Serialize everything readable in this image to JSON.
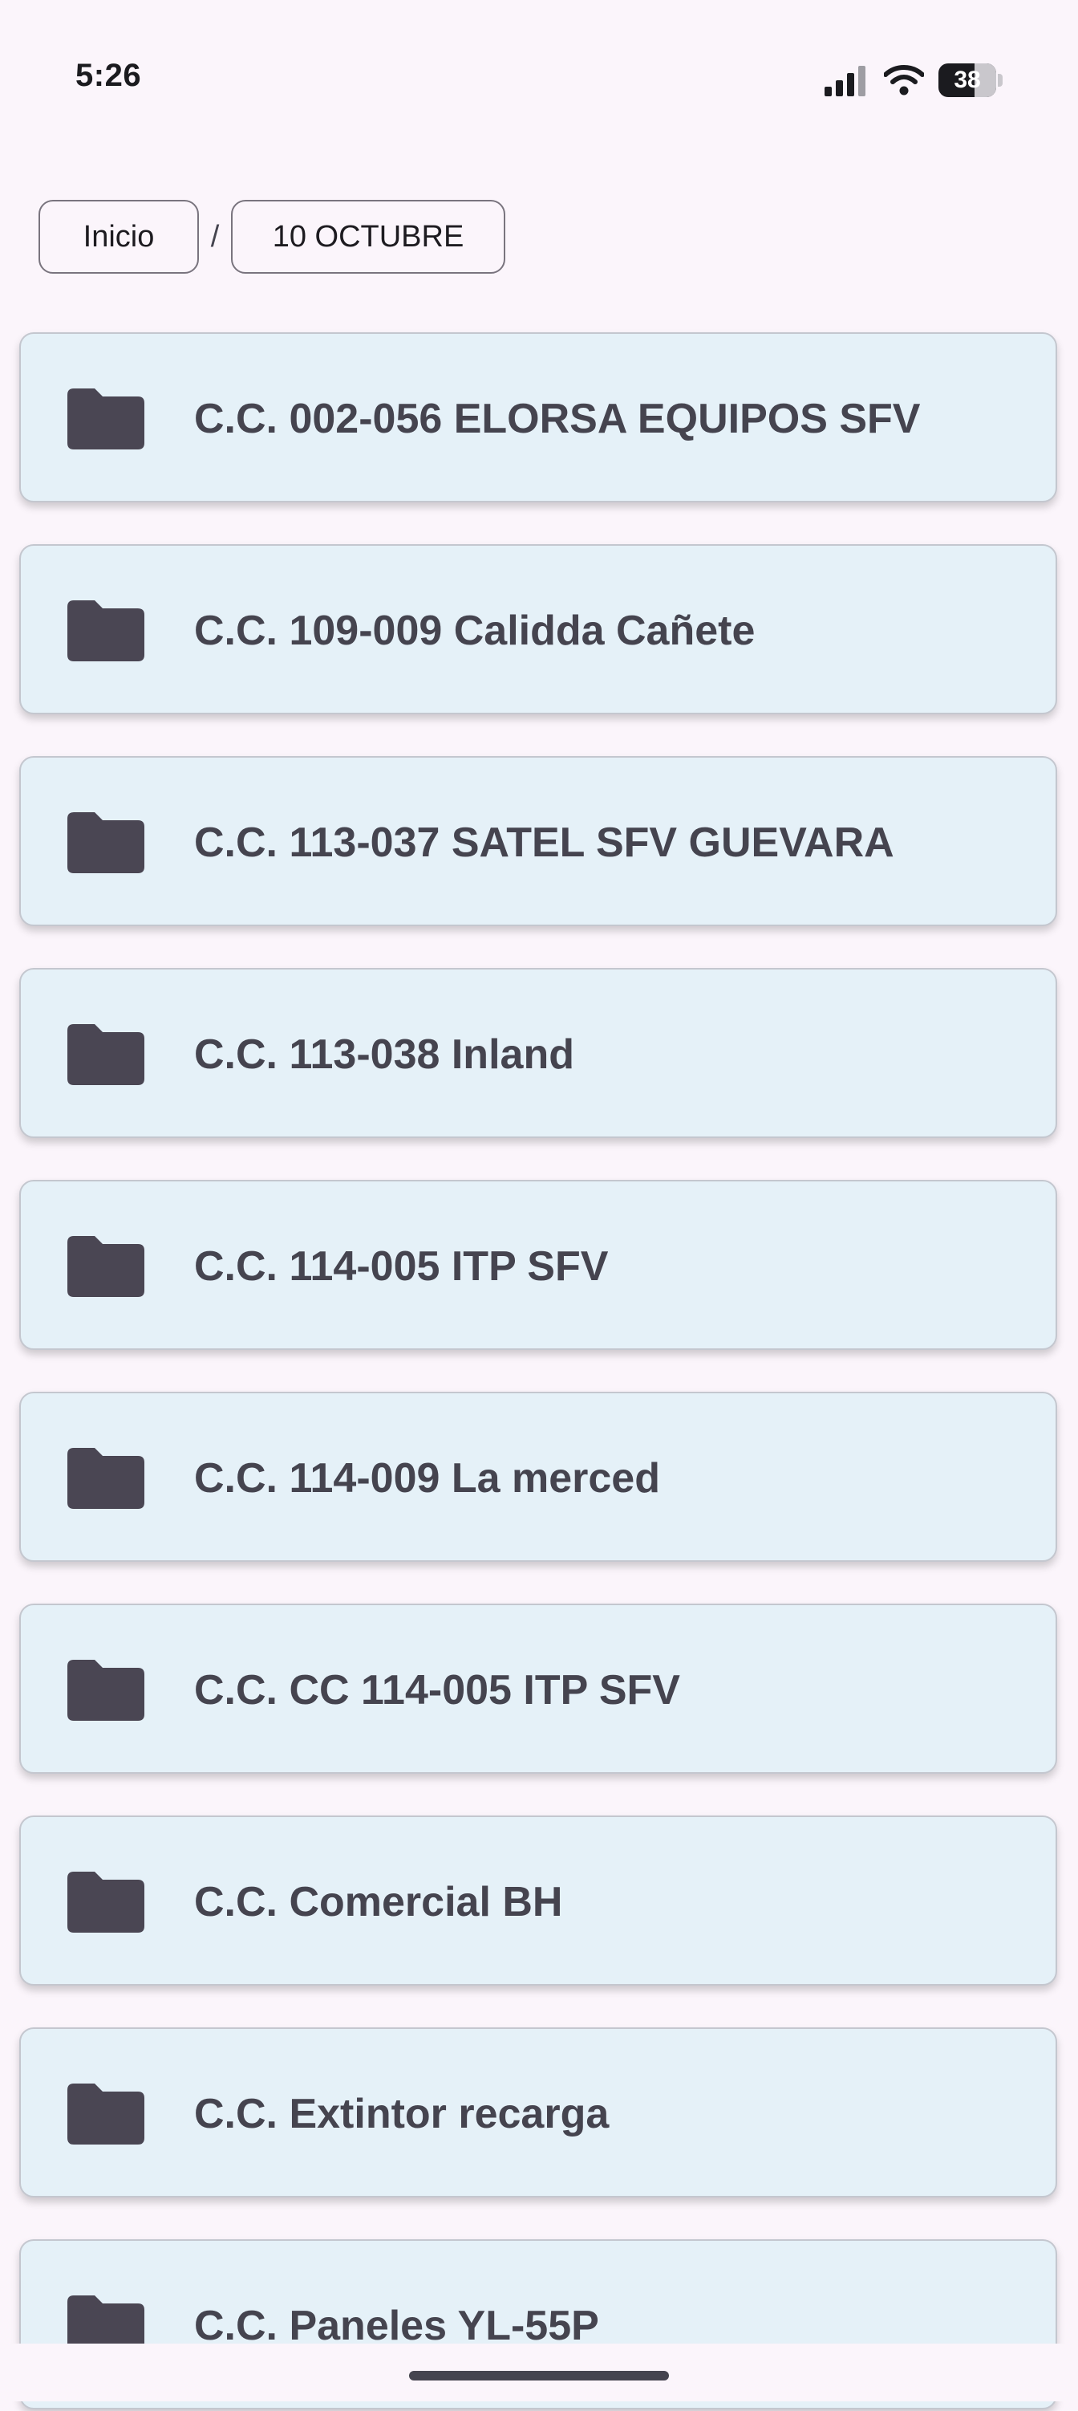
{
  "status_bar": {
    "time": "5:26",
    "battery": "38",
    "icons": [
      "signal-icon",
      "wifi-icon",
      "battery-icon"
    ]
  },
  "breadcrumb": {
    "home": "Inicio",
    "separator": "/",
    "current": "10 OCTUBRE"
  },
  "folders": [
    {
      "label": "C.C. 002-056 ELORSA EQUIPOS SFV"
    },
    {
      "label": "C.C. 109-009 Calidda Cañete"
    },
    {
      "label": "C.C. 113-037 SATEL SFV GUEVARA"
    },
    {
      "label": "C.C. 113-038 Inland"
    },
    {
      "label": "C.C. 114-005 ITP SFV"
    },
    {
      "label": "C.C. 114-009 La merced"
    },
    {
      "label": "C.C. CC 114-005 ITP SFV"
    },
    {
      "label": "C.C. Comercial BH"
    },
    {
      "label": "C.C. Extintor recarga"
    },
    {
      "label": "C.C. Paneles YL-55P"
    }
  ],
  "colors": {
    "background": "#fbf5fb",
    "card": "#e5f1f8",
    "icon": "#4a4653",
    "text": "#45444f"
  }
}
